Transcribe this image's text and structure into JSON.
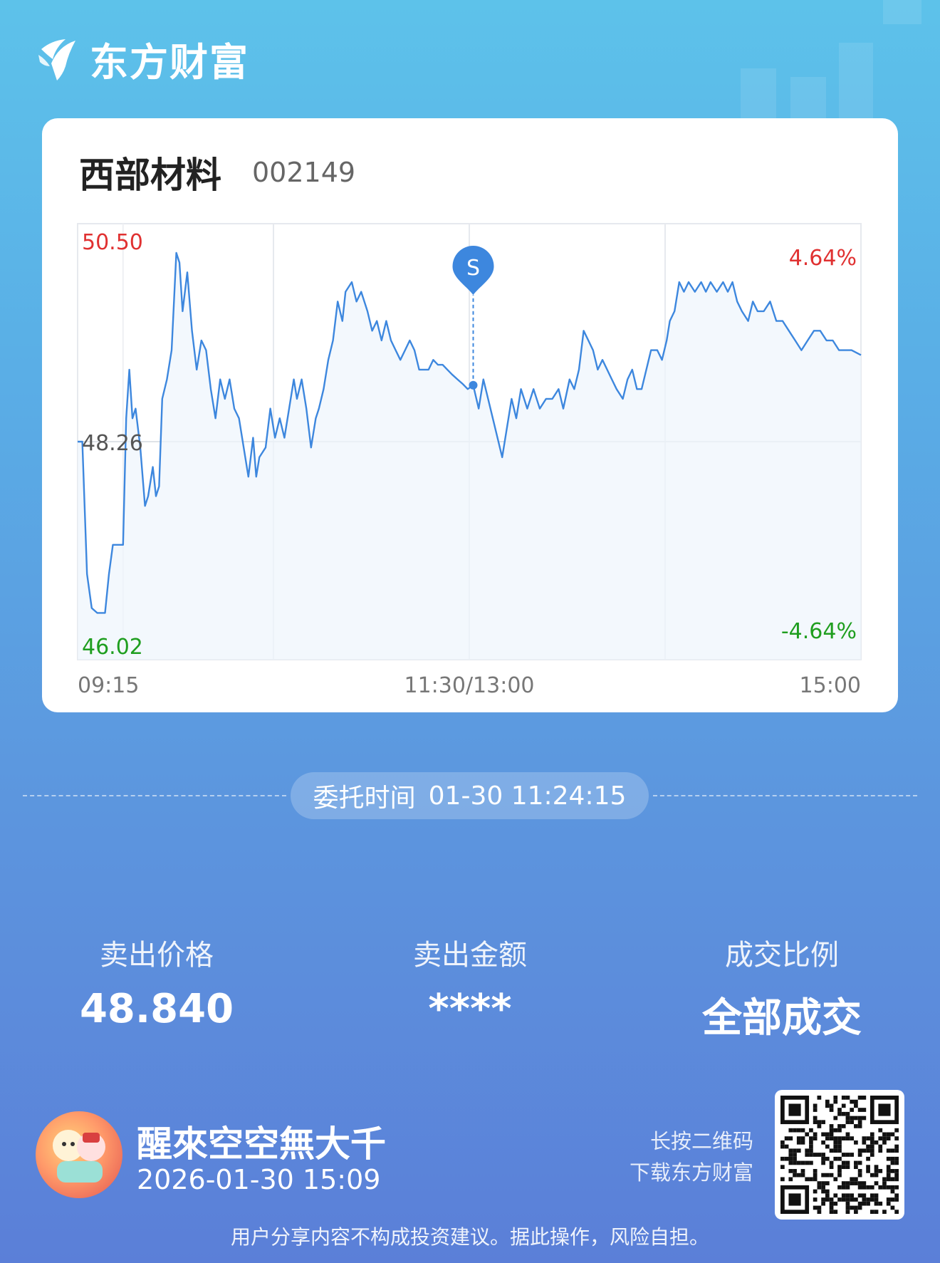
{
  "app": {
    "brand": "东方财富"
  },
  "stock": {
    "name": "西部材料",
    "code": "002149"
  },
  "chart_data": {
    "type": "line",
    "y_max_label": "50.50",
    "y_mid_label": "48.26",
    "y_min_label": "46.02",
    "pct_up_label": "4.64%",
    "pct_down_label": "-4.64%",
    "x_labels": [
      "09:15",
      "11:30/13:00",
      "15:00"
    ],
    "ylim": [
      46.02,
      50.5
    ],
    "prev_close": 48.26,
    "marker": {
      "label": "S",
      "price": 48.84,
      "t": 0.505
    },
    "series": [
      {
        "color": "#3d87de",
        "points": [
          [
            0,
            48.26
          ],
          [
            0.006,
            48.26
          ],
          [
            0.012,
            46.9
          ],
          [
            0.018,
            46.55
          ],
          [
            0.025,
            46.5
          ],
          [
            0.035,
            46.5
          ],
          [
            0.04,
            46.9
          ],
          [
            0.045,
            47.2
          ],
          [
            0.058,
            47.2
          ],
          [
            0.062,
            48.5
          ],
          [
            0.066,
            49.0
          ],
          [
            0.07,
            48.5
          ],
          [
            0.074,
            48.6
          ],
          [
            0.08,
            48.2
          ],
          [
            0.086,
            47.6
          ],
          [
            0.09,
            47.7
          ],
          [
            0.096,
            48.0
          ],
          [
            0.1,
            47.7
          ],
          [
            0.104,
            47.8
          ],
          [
            0.108,
            48.7
          ],
          [
            0.114,
            48.9
          ],
          [
            0.12,
            49.2
          ],
          [
            0.126,
            50.2
          ],
          [
            0.13,
            50.1
          ],
          [
            0.134,
            49.6
          ],
          [
            0.14,
            50.0
          ],
          [
            0.146,
            49.4
          ],
          [
            0.152,
            49.0
          ],
          [
            0.158,
            49.3
          ],
          [
            0.164,
            49.2
          ],
          [
            0.17,
            48.8
          ],
          [
            0.176,
            48.5
          ],
          [
            0.182,
            48.9
          ],
          [
            0.188,
            48.7
          ],
          [
            0.194,
            48.9
          ],
          [
            0.2,
            48.6
          ],
          [
            0.206,
            48.5
          ],
          [
            0.212,
            48.2
          ],
          [
            0.218,
            47.9
          ],
          [
            0.224,
            48.3
          ],
          [
            0.228,
            47.9
          ],
          [
            0.232,
            48.1
          ],
          [
            0.24,
            48.2
          ],
          [
            0.246,
            48.6
          ],
          [
            0.252,
            48.3
          ],
          [
            0.258,
            48.5
          ],
          [
            0.264,
            48.3
          ],
          [
            0.27,
            48.6
          ],
          [
            0.276,
            48.9
          ],
          [
            0.28,
            48.7
          ],
          [
            0.286,
            48.9
          ],
          [
            0.292,
            48.6
          ],
          [
            0.298,
            48.2
          ],
          [
            0.304,
            48.5
          ],
          [
            0.308,
            48.6
          ],
          [
            0.314,
            48.8
          ],
          [
            0.32,
            49.1
          ],
          [
            0.326,
            49.3
          ],
          [
            0.332,
            49.7
          ],
          [
            0.338,
            49.5
          ],
          [
            0.342,
            49.8
          ],
          [
            0.35,
            49.9
          ],
          [
            0.356,
            49.7
          ],
          [
            0.362,
            49.8
          ],
          [
            0.37,
            49.6
          ],
          [
            0.376,
            49.4
          ],
          [
            0.382,
            49.5
          ],
          [
            0.388,
            49.3
          ],
          [
            0.394,
            49.5
          ],
          [
            0.4,
            49.3
          ],
          [
            0.406,
            49.2
          ],
          [
            0.412,
            49.1
          ],
          [
            0.418,
            49.2
          ],
          [
            0.424,
            49.3
          ],
          [
            0.43,
            49.2
          ],
          [
            0.436,
            49.0
          ],
          [
            0.442,
            49.0
          ],
          [
            0.448,
            49.0
          ],
          [
            0.454,
            49.1
          ],
          [
            0.46,
            49.05
          ],
          [
            0.466,
            49.05
          ],
          [
            0.472,
            49.0
          ],
          [
            0.478,
            48.95
          ],
          [
            0.485,
            48.9
          ],
          [
            0.492,
            48.85
          ],
          [
            0.498,
            48.8
          ],
          [
            0.505,
            48.84
          ],
          [
            0.512,
            48.6
          ],
          [
            0.518,
            48.9
          ],
          [
            0.524,
            48.7
          ],
          [
            0.53,
            48.5
          ],
          [
            0.536,
            48.3
          ],
          [
            0.542,
            48.1
          ],
          [
            0.548,
            48.4
          ],
          [
            0.554,
            48.7
          ],
          [
            0.56,
            48.5
          ],
          [
            0.566,
            48.8
          ],
          [
            0.574,
            48.6
          ],
          [
            0.582,
            48.8
          ],
          [
            0.59,
            48.6
          ],
          [
            0.598,
            48.7
          ],
          [
            0.606,
            48.7
          ],
          [
            0.614,
            48.8
          ],
          [
            0.62,
            48.6
          ],
          [
            0.628,
            48.9
          ],
          [
            0.634,
            48.8
          ],
          [
            0.64,
            49.0
          ],
          [
            0.646,
            49.4
          ],
          [
            0.652,
            49.3
          ],
          [
            0.658,
            49.2
          ],
          [
            0.664,
            49.0
          ],
          [
            0.67,
            49.1
          ],
          [
            0.676,
            49.0
          ],
          [
            0.682,
            48.9
          ],
          [
            0.688,
            48.8
          ],
          [
            0.696,
            48.7
          ],
          [
            0.702,
            48.9
          ],
          [
            0.708,
            49.0
          ],
          [
            0.714,
            48.8
          ],
          [
            0.72,
            48.8
          ],
          [
            0.726,
            49.0
          ],
          [
            0.732,
            49.2
          ],
          [
            0.74,
            49.2
          ],
          [
            0.746,
            49.1
          ],
          [
            0.752,
            49.3
          ],
          [
            0.756,
            49.5
          ],
          [
            0.762,
            49.6
          ],
          [
            0.768,
            49.9
          ],
          [
            0.774,
            49.8
          ],
          [
            0.78,
            49.9
          ],
          [
            0.788,
            49.8
          ],
          [
            0.796,
            49.9
          ],
          [
            0.802,
            49.8
          ],
          [
            0.808,
            49.9
          ],
          [
            0.816,
            49.8
          ],
          [
            0.824,
            49.9
          ],
          [
            0.83,
            49.8
          ],
          [
            0.836,
            49.9
          ],
          [
            0.842,
            49.7
          ],
          [
            0.848,
            49.6
          ],
          [
            0.856,
            49.5
          ],
          [
            0.862,
            49.7
          ],
          [
            0.868,
            49.6
          ],
          [
            0.876,
            49.6
          ],
          [
            0.884,
            49.7
          ],
          [
            0.892,
            49.5
          ],
          [
            0.9,
            49.5
          ],
          [
            0.908,
            49.4
          ],
          [
            0.916,
            49.3
          ],
          [
            0.924,
            49.2
          ],
          [
            0.932,
            49.3
          ],
          [
            0.94,
            49.4
          ],
          [
            0.948,
            49.4
          ],
          [
            0.956,
            49.3
          ],
          [
            0.964,
            49.3
          ],
          [
            0.972,
            49.2
          ],
          [
            0.98,
            49.2
          ],
          [
            0.988,
            49.2
          ],
          [
            1.0,
            49.15
          ]
        ]
      }
    ]
  },
  "order": {
    "label": "委托时间",
    "value": "01-30 11:24:15"
  },
  "stats": [
    {
      "label": "卖出价格",
      "value": "48.840"
    },
    {
      "label": "卖出金额",
      "value": "****"
    },
    {
      "label": "成交比例",
      "value": "全部成交"
    }
  ],
  "user": {
    "name": "醒來空空無大千",
    "time": "2026-01-30 15:09"
  },
  "qr": {
    "line1": "长按二维码",
    "line2": "下载东方财富"
  },
  "disclaimer": "用户分享内容不构成投资建议。据此操作，风险自担。",
  "colors": {
    "up": "#e03131",
    "down": "#1f9e1f",
    "line": "#3d87de"
  }
}
